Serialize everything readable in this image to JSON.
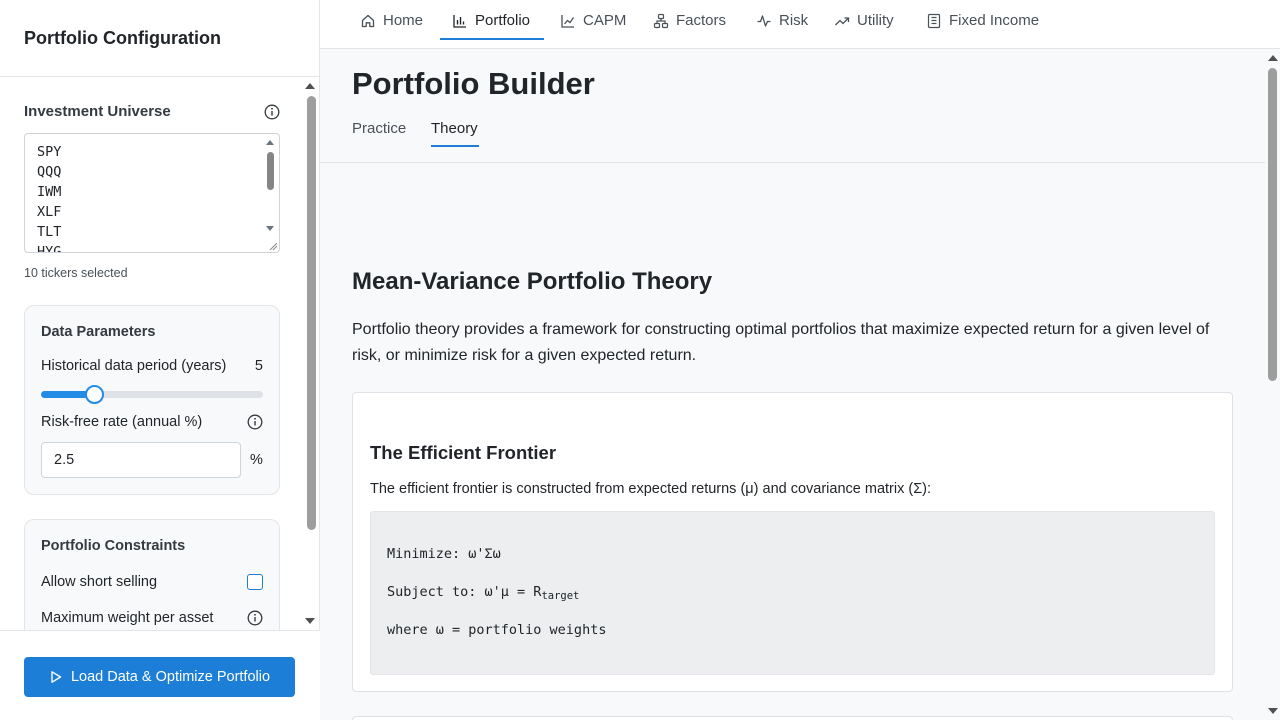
{
  "sidebar": {
    "title": "Portfolio Configuration",
    "universe": {
      "label": "Investment Universe",
      "tickers": [
        "SPY",
        "QQQ",
        "IWM",
        "XLF",
        "TLT",
        "HYG"
      ],
      "count_text": "10 tickers selected"
    },
    "data_params": {
      "title": "Data Parameters",
      "period_label": "Historical data period (years)",
      "period_value": "5",
      "period_fill_fraction": 0.24,
      "rf_label": "Risk-free rate (annual %)",
      "rf_value": "2.5",
      "rf_unit": "%"
    },
    "constraints": {
      "title": "Portfolio Constraints",
      "short_label": "Allow short selling",
      "short_checked": false,
      "max_weight_label": "Maximum weight per asset"
    },
    "load_button": "Load Data & Optimize Portfolio"
  },
  "nav": {
    "items": [
      {
        "label": "Home",
        "icon": "home-icon"
      },
      {
        "label": "Portfolio",
        "icon": "bar-chart-icon"
      },
      {
        "label": "CAPM",
        "icon": "line-chart-icon"
      },
      {
        "label": "Factors",
        "icon": "hierarchy-icon"
      },
      {
        "label": "Risk",
        "icon": "activity-icon"
      },
      {
        "label": "Utility",
        "icon": "trending-up-icon"
      },
      {
        "label": "Fixed Income",
        "icon": "building-icon"
      }
    ],
    "active": "Portfolio"
  },
  "page": {
    "title": "Portfolio Builder",
    "subtabs": [
      "Practice",
      "Theory"
    ],
    "active_subtab": "Theory"
  },
  "theory": {
    "title": "Mean-Variance Portfolio Theory",
    "intro": "Portfolio theory provides a framework for constructing optimal portfolios that maximize expected return for a given level of risk, or minimize risk for a given expected return.",
    "frontier": {
      "title": "The Efficient Frontier",
      "desc": "The efficient frontier is constructed from expected returns (μ) and covariance matrix (Σ):",
      "line1": "Minimize: ω'Σω",
      "line2_prefix": "Subject to: ω'μ = R",
      "line2_sub": "target",
      "line3": "where ω = portfolio weights"
    }
  },
  "colors": {
    "accent": "#1c7ed6",
    "sidebar_bg": "#ffffff",
    "main_bg": "#f8f9fa",
    "code_bg": "#eceeef"
  }
}
